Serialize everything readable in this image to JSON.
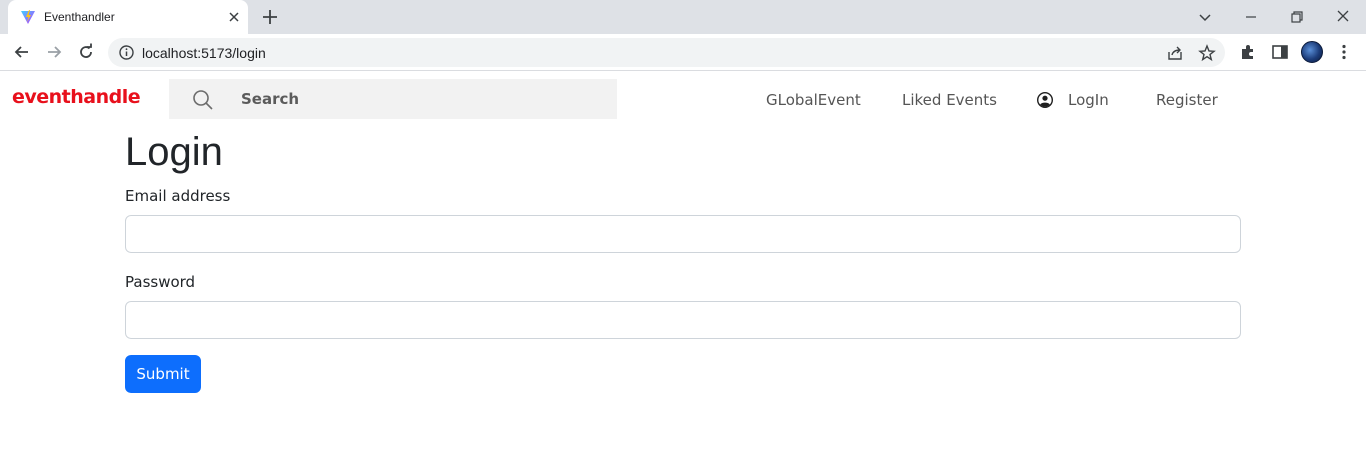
{
  "browser": {
    "tab": {
      "title": "Eventhandler",
      "favicon": "vite-logo-icon"
    },
    "url": "localhost:5173/login"
  },
  "navbar": {
    "brand": "eventhandle",
    "search": {
      "placeholder": "Search",
      "value": ""
    },
    "links": {
      "global": "GLobalEvent",
      "liked": "Liked Events",
      "login": "LogIn",
      "register": "Register"
    }
  },
  "form": {
    "title": "Login",
    "email_label": "Email address",
    "email_value": "",
    "password_label": "Password",
    "password_value": "",
    "submit_label": "Submit"
  },
  "colors": {
    "brand": "#e8101c",
    "primary": "#0d6efd"
  }
}
